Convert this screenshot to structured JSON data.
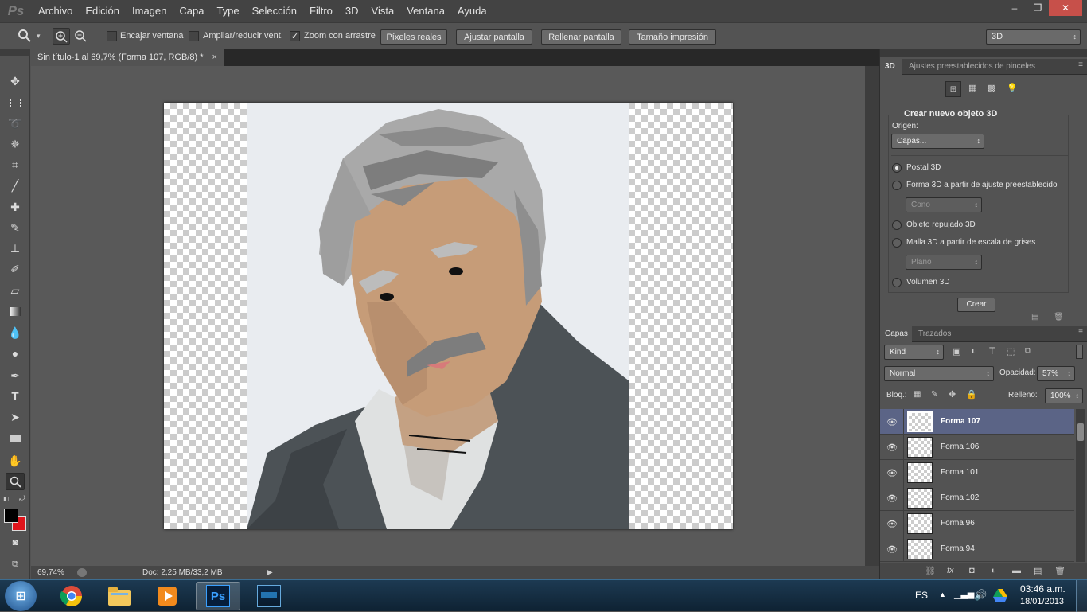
{
  "app": {
    "logo": "Ps",
    "menu": [
      "Archivo",
      "Edición",
      "Imagen",
      "Capa",
      "Type",
      "Selección",
      "Filtro",
      "3D",
      "Vista",
      "Ventana",
      "Ayuda"
    ],
    "window_controls": {
      "minimize": "–",
      "restore": "❐",
      "close": "✕"
    }
  },
  "options": {
    "zoom_tool_icon": "magnifier-icon",
    "encajar_label": "Encajar ventana",
    "encajar_checked": false,
    "ampliar_label": "Ampliar/reducir vent.",
    "ampliar_checked": false,
    "zoom_arrastre_label": "Zoom con arrastre",
    "zoom_arrastre_checked": true,
    "btn_pixeles": "Píxeles reales",
    "btn_ajustar": "Ajustar pantalla",
    "btn_rellenar": "Rellenar pantalla",
    "btn_tamano": "Tamaño impresión",
    "workspace": "3D"
  },
  "document": {
    "tab_title": "Sin título-1 al 69,7% (Forma 107, RGB/8) *",
    "close": "×",
    "zoom": "69,74%",
    "doc_size": "Doc: 2,25 MB/33,2 MB"
  },
  "panel3d": {
    "tabs": [
      "3D",
      "Ajustes preestablecidos de pinceles"
    ],
    "section_title": "Crear nuevo objeto 3D",
    "origin_label": "Origen:",
    "origin_value": "Capas...",
    "options": [
      {
        "label": "Postal 3D",
        "selected": true
      },
      {
        "label": "Forma 3D a partir de ajuste preestablecido",
        "selected": false
      },
      {
        "label": "Objeto repujado 3D",
        "selected": false
      },
      {
        "label": "Malla 3D a partir de escala de grises",
        "selected": false
      },
      {
        "label": "Volumen 3D",
        "selected": false
      }
    ],
    "shape_dropdown": "Cono",
    "mesh_dropdown": "Plano",
    "create_button": "Crear"
  },
  "layers": {
    "tabs": [
      "Capas",
      "Trazados"
    ],
    "filter": "Kind",
    "blend_mode": "Normal",
    "opacity_label": "Opacidad:",
    "opacity_value": "57%",
    "lock_label": "Bloq.:",
    "fill_label": "Relleno:",
    "fill_value": "100%",
    "items": [
      {
        "name": "Forma 107",
        "selected": true
      },
      {
        "name": "Forma 106",
        "selected": false
      },
      {
        "name": "Forma 101",
        "selected": false
      },
      {
        "name": "Forma 102",
        "selected": false
      },
      {
        "name": "Forma 96",
        "selected": false
      },
      {
        "name": "Forma 94",
        "selected": false
      }
    ]
  },
  "taskbar": {
    "language": "ES",
    "time": "03:46 a.m.",
    "date": "18/01/2013"
  },
  "colors": {
    "foreground": "#000000",
    "background": "#e0141b",
    "selected_layer": "#5b6486"
  }
}
